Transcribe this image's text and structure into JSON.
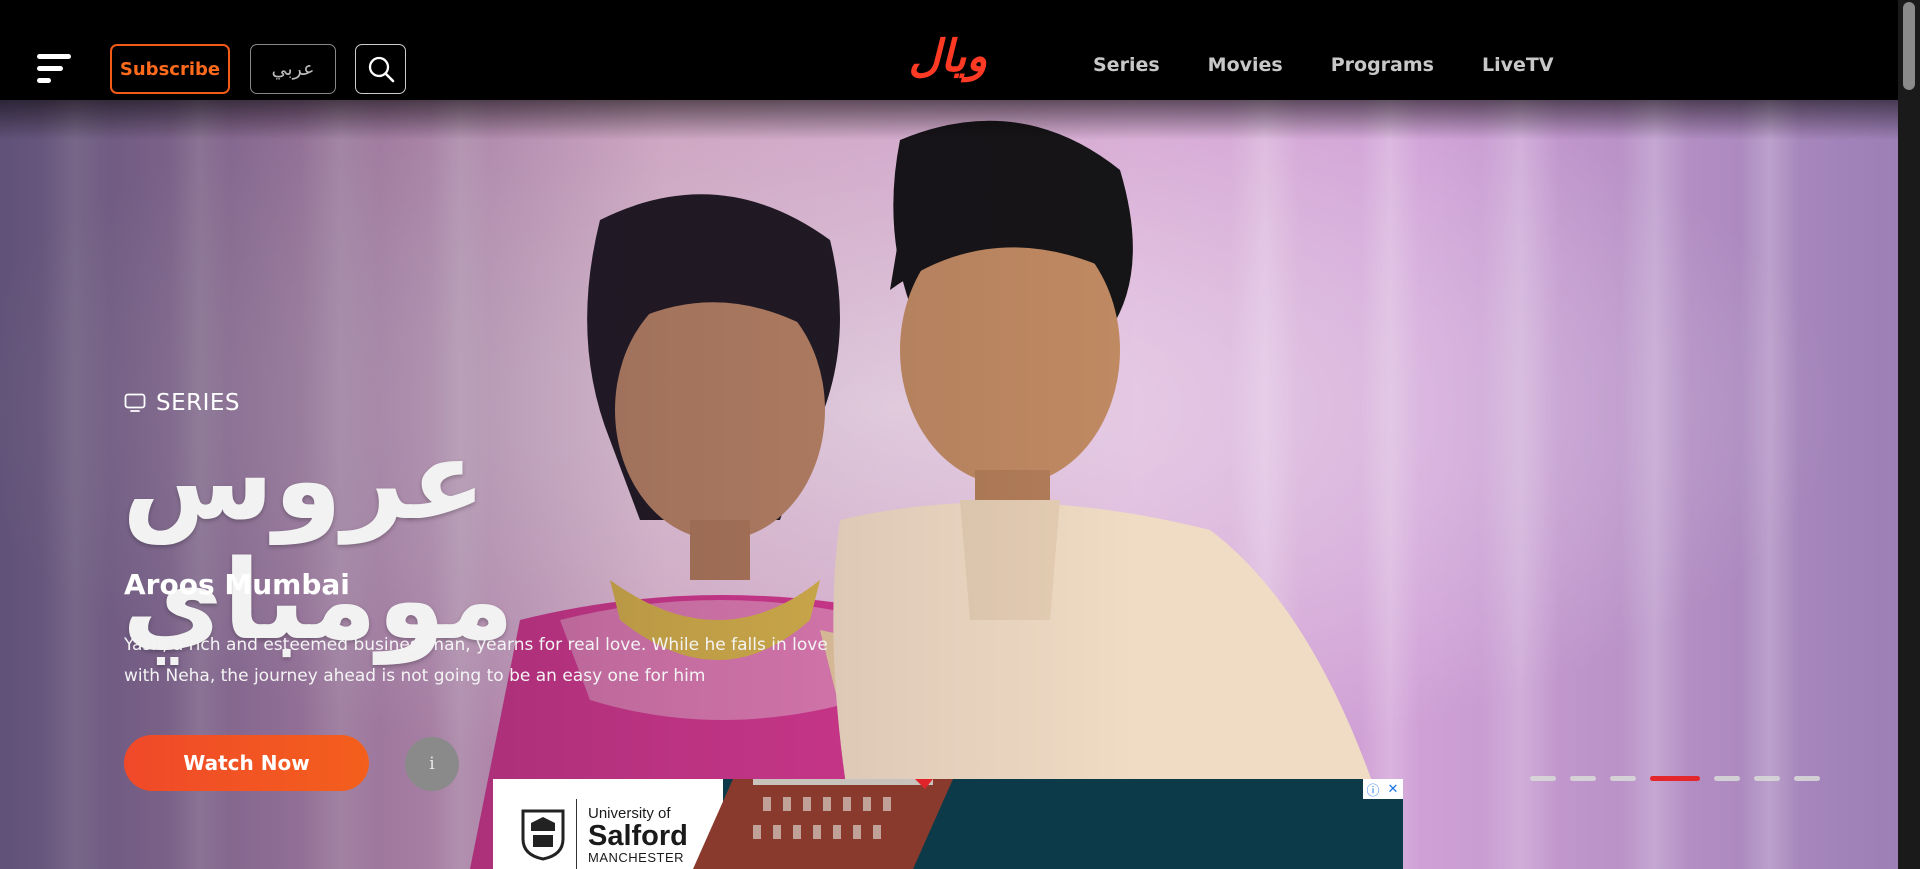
{
  "header": {
    "menu_icon": "hamburger-menu-icon",
    "subscribe_label": "Subscribe",
    "language_label": "عربي",
    "search_icon": "search-icon",
    "logo_text": "ويال",
    "nav": [
      {
        "label": "Series"
      },
      {
        "label": "Movies"
      },
      {
        "label": "Programs"
      },
      {
        "label": "LiveTV"
      }
    ]
  },
  "hero": {
    "type_icon": "tv-icon",
    "type_label": "SERIES",
    "title_ar": "عروس مومباي",
    "title_en": "Aroos Mumbai",
    "description": "Yash, a rich and esteemed businessman, yearns for real love. While he falls in love with Neha, the journey ahead is not going to be an easy one for him",
    "watch_label": "Watch Now",
    "info_label": "i",
    "carousel": {
      "count": 7,
      "active_index": 3
    }
  },
  "ad": {
    "line1": "University of",
    "line2": "Salford",
    "line3": "MANCHESTER",
    "adchoices_icon": "adchoices-icon",
    "close_icon": "close-icon"
  },
  "colors": {
    "accent": "#f25a16",
    "logo": "#ff3a24",
    "active_dot": "#e3272b",
    "ad_bg": "#0c3a48"
  }
}
